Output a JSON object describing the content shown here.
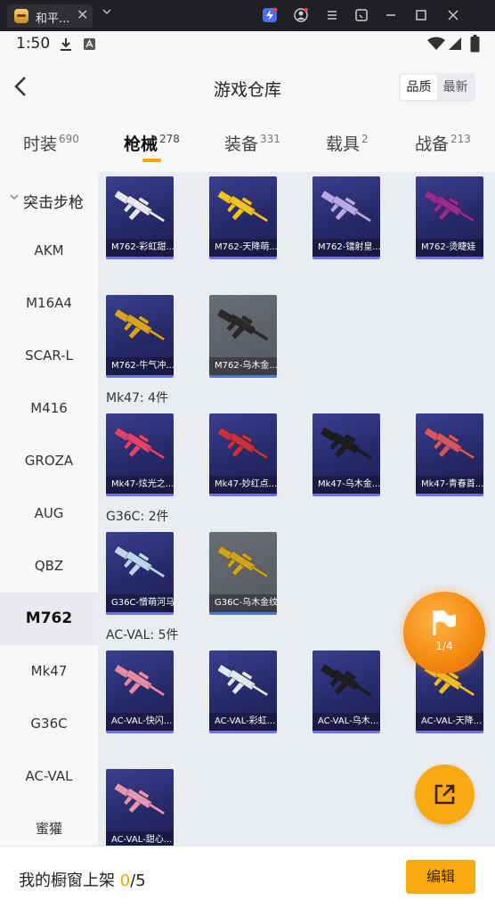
{
  "window": {
    "tab_title": "和平...",
    "tab_close": "✕"
  },
  "status_bar": {
    "time": "1:50"
  },
  "header": {
    "title": "游戏仓库",
    "sort_options": [
      {
        "label": "品质",
        "active": true
      },
      {
        "label": "最新",
        "active": false
      }
    ]
  },
  "tabs": [
    {
      "label": "时装",
      "count": "690"
    },
    {
      "label": "枪械",
      "count": "278",
      "active": true
    },
    {
      "label": "装备",
      "count": "331"
    },
    {
      "label": "载具",
      "count": "2"
    },
    {
      "label": "战备",
      "count": "213"
    }
  ],
  "sidebar": {
    "group": "突击步枪",
    "items": [
      "AKM",
      "M16A4",
      "SCAR-L",
      "M416",
      "GROZA",
      "AUG",
      "QBZ",
      "M762",
      "Mk47",
      "G36C",
      "AC-VAL",
      "蜜獾"
    ],
    "active": "M762"
  },
  "sections": [
    {
      "label": "",
      "cards": [
        {
          "name": "M762-彩虹甜...",
          "style": "blue",
          "color": "#e8e8f0"
        },
        {
          "name": "M762-天降萌...",
          "style": "blue",
          "color": "#f2c21f"
        },
        {
          "name": "M762-镭射皇...",
          "style": "blue",
          "color": "#b7a9e6"
        },
        {
          "name": "M762-烫睫娃",
          "style": "blue",
          "color": "#9a2a8c"
        },
        {
          "name": "M762-牛气冲...",
          "style": "blue",
          "color": "#d9a21f"
        },
        {
          "name": "M762-乌木金...",
          "style": "gray",
          "color": "#2a2a2a"
        }
      ]
    },
    {
      "label": "Mk47: 4件",
      "cards": [
        {
          "name": "Mk47-炫光之...",
          "style": "blue",
          "color": "#e2416b"
        },
        {
          "name": "Mk47-妙红点...",
          "style": "blue",
          "color": "#c7323d"
        },
        {
          "name": "Mk47-乌木金...",
          "style": "blue",
          "color": "#1d1d1d"
        },
        {
          "name": "Mk47-青春首...",
          "style": "blue",
          "color": "#d55660"
        }
      ]
    },
    {
      "label": "G36C: 2件",
      "cards": [
        {
          "name": "G36C-憎萌河马",
          "style": "blue",
          "color": "#bfd6ea"
        },
        {
          "name": "G36C-乌木金纹",
          "style": "gray",
          "color": "#d1a318"
        }
      ]
    },
    {
      "label": "AC-VAL: 5件",
      "cards": [
        {
          "name": "AC-VAL-快闪...",
          "style": "blue",
          "color": "#e58aa8"
        },
        {
          "name": "AC-VAL-彩虹...",
          "style": "blue",
          "color": "#dfe8ee"
        },
        {
          "name": "AC-VAL-乌木...",
          "style": "blue",
          "color": "#1e1e1e"
        },
        {
          "name": "AC-VAL-天降...",
          "style": "blue",
          "color": "#efbd26"
        },
        {
          "name": "AC-VAL-甜心...",
          "style": "blue",
          "color": "#e696b3"
        }
      ]
    }
  ],
  "floating": {
    "flag_count": "1/4"
  },
  "bottom_bar": {
    "label": "我的橱窗上架",
    "current": "0",
    "total": "/5",
    "edit_label": "编辑"
  },
  "colors": {
    "accent": "#f8aa10",
    "card_blue": "#26296a",
    "card_gray": "#55585f"
  }
}
